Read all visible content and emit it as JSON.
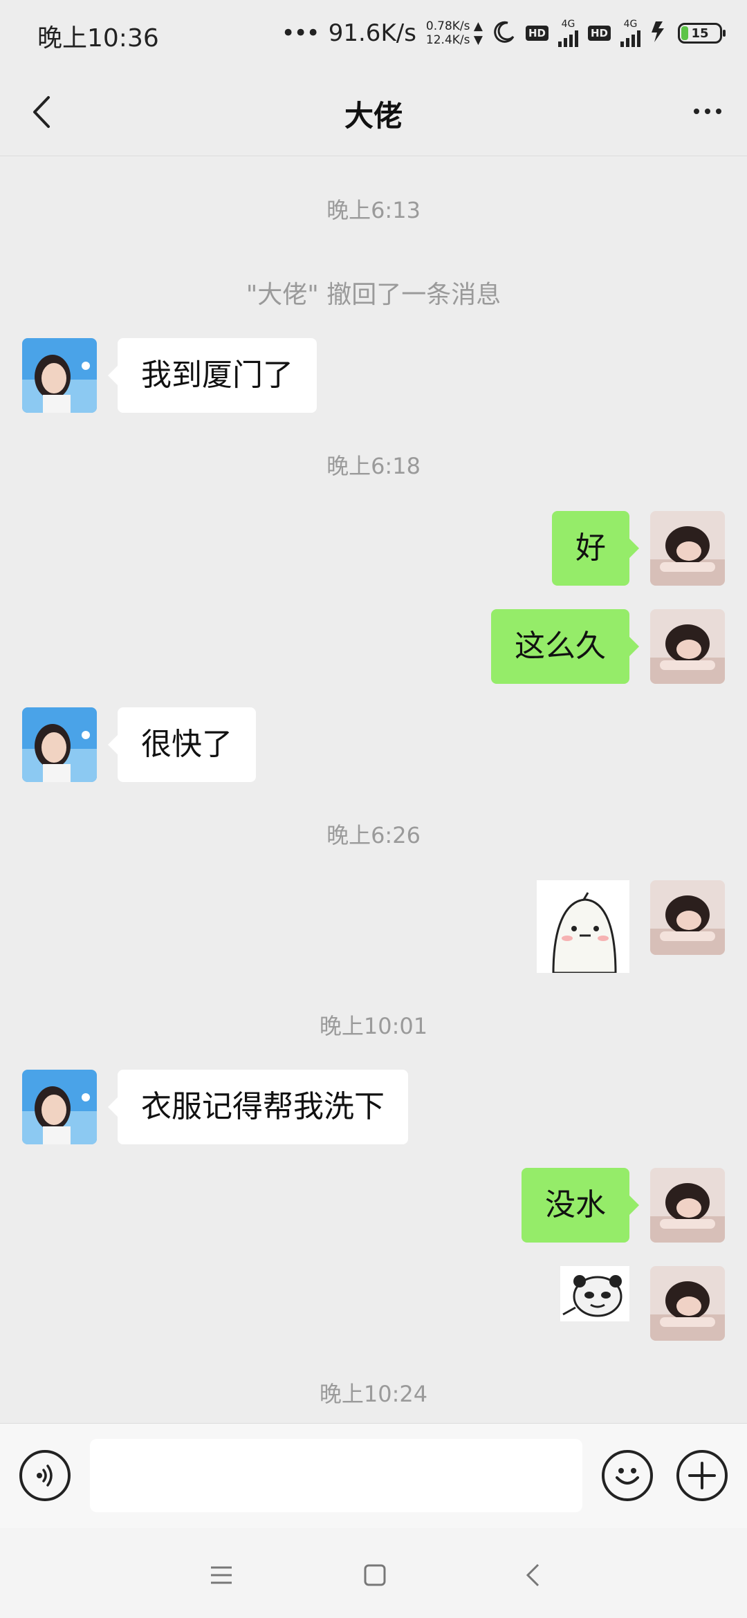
{
  "status_bar": {
    "time": "晚上10:36",
    "signal_dots": "•••",
    "net_speed": "91.6K/s",
    "upload_speed": "0.78K/s ▲",
    "download_speed": "12.4K/s ▼",
    "hd_label": "HD",
    "network_label": "4G",
    "battery_level": "15"
  },
  "header": {
    "title": "大佬"
  },
  "chat": {
    "timestamps": [
      "晚上6:13",
      "晚上6:18",
      "晚上6:26",
      "晚上10:01",
      "晚上10:24"
    ],
    "recall_notice": "\"大佬\" 撤回了一条消息",
    "messages": [
      {
        "from": "them",
        "text": "我到厦门了"
      },
      {
        "from": "me",
        "text": "好"
      },
      {
        "from": "me",
        "text": "这么久"
      },
      {
        "from": "them",
        "text": "很快了"
      },
      {
        "from": "me",
        "type": "sticker",
        "sticker": "ghost-sticker"
      },
      {
        "from": "them",
        "text": "衣服记得帮我洗下"
      },
      {
        "from": "me",
        "text": "没水"
      },
      {
        "from": "me",
        "type": "sticker",
        "sticker": "panda-meme-sticker"
      }
    ]
  },
  "input_bar": {
    "value": "",
    "placeholder": ""
  },
  "colors": {
    "background": "#ededed",
    "bubble_out": "#95ec69",
    "bubble_in": "#ffffff",
    "battery_fill": "#5cc447"
  }
}
